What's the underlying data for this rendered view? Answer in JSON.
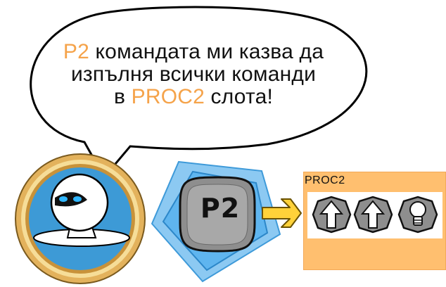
{
  "speech": {
    "line1_highlight": "P2",
    "line1_rest": " командата ми казва да",
    "line2": "изпълня всички команди",
    "line3_prefix": "в ",
    "line3_highlight": "PROC2",
    "line3_suffix": " слота!"
  },
  "command_key": {
    "label": "P2"
  },
  "proc_panel": {
    "label": "PROC2",
    "slots": [
      {
        "icon": "arrow-up-icon"
      },
      {
        "icon": "arrow-up-icon"
      },
      {
        "icon": "lightbulb-icon"
      }
    ]
  },
  "colors": {
    "highlight": "#f5a34a",
    "proc_background": "#ffbf6f",
    "command_blue": "#4aa8e8",
    "arrow_yellow": "#ffd23a",
    "avatar_blue": "#3d9ad6",
    "medallion_gold": "#d9a445"
  }
}
